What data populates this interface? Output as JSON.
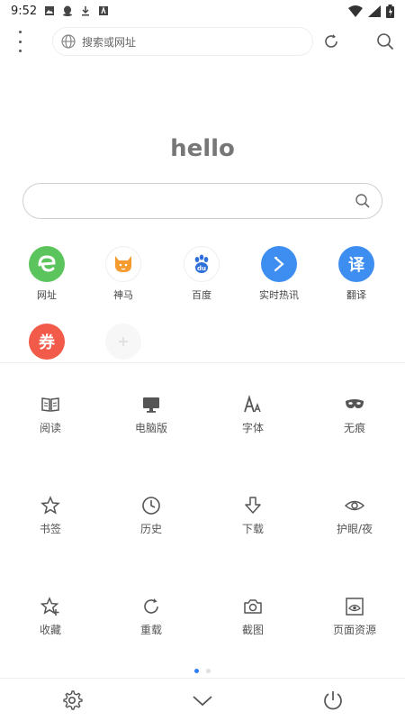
{
  "status_bar": {
    "time": "9:52"
  },
  "top_bar": {
    "search_placeholder": "搜索或网址"
  },
  "home": {
    "title": "hello"
  },
  "shortcuts": [
    {
      "label": "网址",
      "icon": "e-browser-icon",
      "color": "#5cc45c",
      "glyph": "e"
    },
    {
      "label": "神马",
      "icon": "shenma-icon",
      "color": "#ffffff",
      "glyph": ""
    },
    {
      "label": "百度",
      "icon": "baidu-paw-icon",
      "color": "#ffffff",
      "glyph": ""
    },
    {
      "label": "实时热讯",
      "icon": "arrow-icon",
      "color": "#3d8ef0",
      "glyph": ""
    },
    {
      "label": "翻译",
      "icon": "translate-icon",
      "color": "#3d8ef0",
      "glyph": "译"
    },
    {
      "label": "",
      "icon": "coupon-icon",
      "color": "#f25a4a",
      "glyph": "券"
    },
    {
      "label": "",
      "icon": "add-icon",
      "color": "#f7f7f7",
      "glyph": ""
    }
  ],
  "menu": {
    "row1": [
      "阅读",
      "电脑版",
      "字体",
      "无痕"
    ],
    "row2": [
      "书签",
      "历史",
      "下载",
      "护眼/夜"
    ],
    "row3": [
      "收藏",
      "重载",
      "截图",
      "页面资源"
    ]
  },
  "pager": {
    "active_color": "#2e7cf6"
  }
}
